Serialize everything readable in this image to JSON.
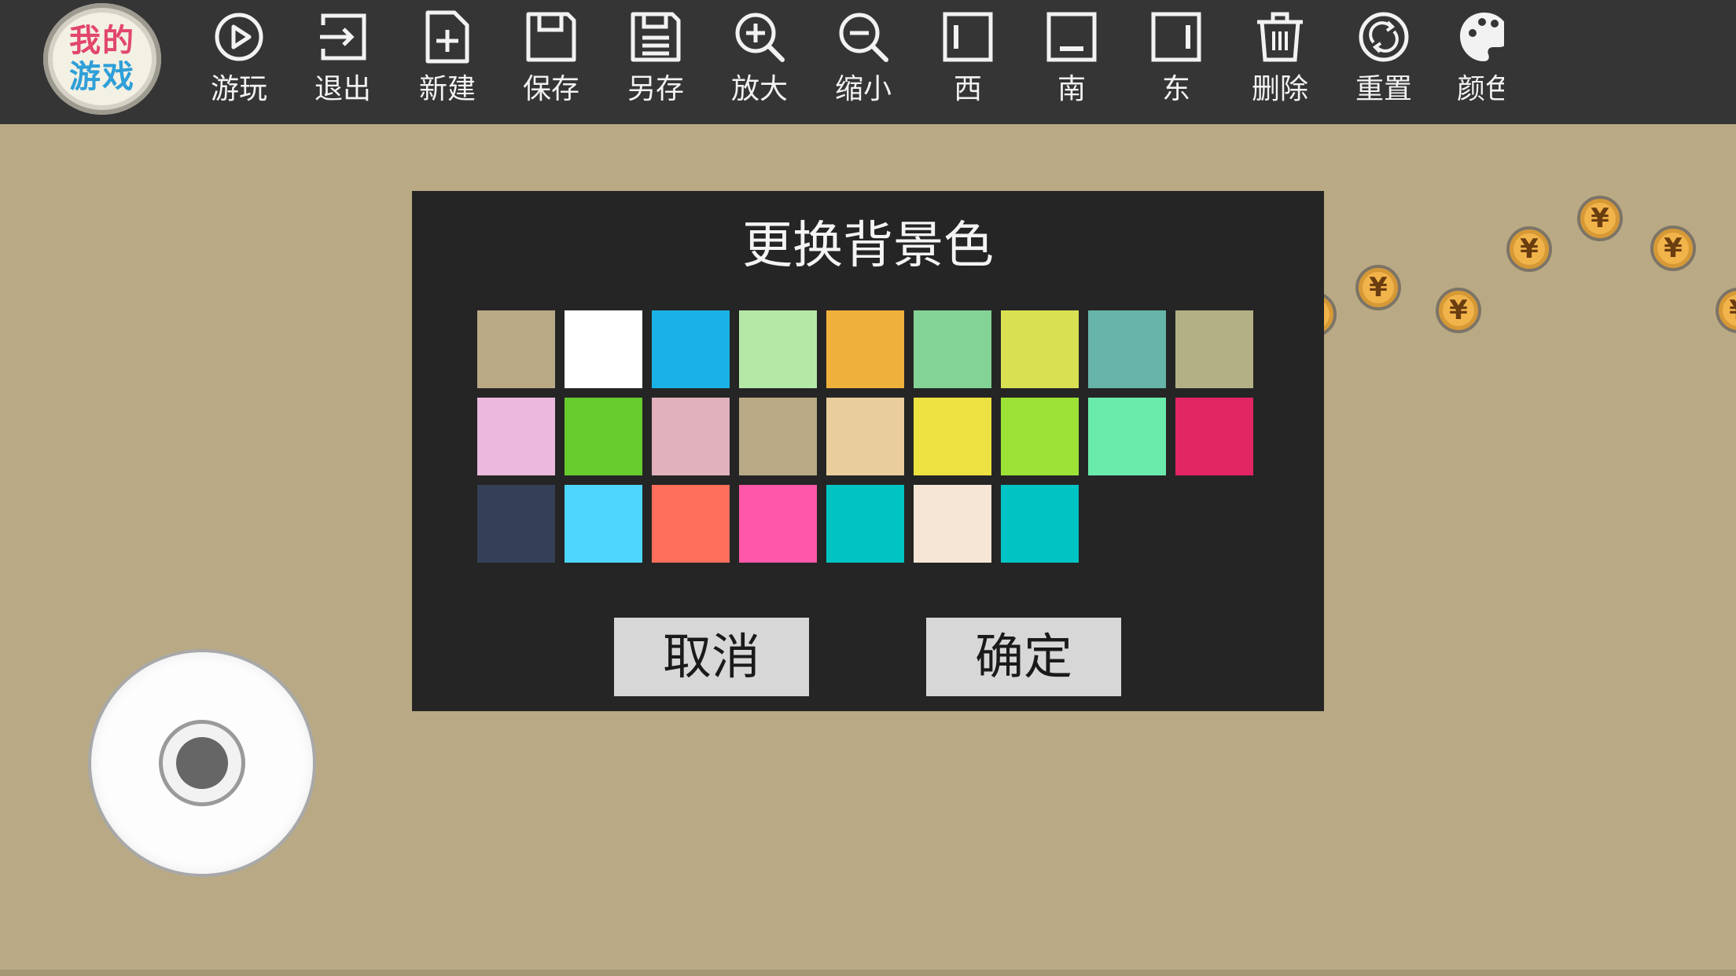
{
  "logo": {
    "line1": "我的",
    "line2": "游戏"
  },
  "toolbar": {
    "play": "游玩",
    "exit": "退出",
    "new": "新建",
    "save": "保存",
    "save_as": "另存",
    "zoom_in": "放大",
    "zoom_out": "缩小",
    "west": "西",
    "south": "南",
    "east": "东",
    "delete": "删除",
    "reset": "重置",
    "color": "颜色"
  },
  "dialog": {
    "title": "更换背景色",
    "cancel_label": "取消",
    "ok_label": "确定",
    "swatches": [
      "#b9aa85",
      "#ffffff",
      "#1ab1e6",
      "#b5e8a7",
      "#efb13c",
      "#83d397",
      "#d9e052",
      "#67b4a8",
      "#b3b085",
      "#ebb8de",
      "#66cc2e",
      "#e1b1bd",
      "#b9aa85",
      "#eacd9c",
      "#ece140",
      "#9ce236",
      "#6aebac",
      "#e22563",
      "#353f57",
      "#4ed6ff",
      "#ff6f5c",
      "#ff58a9",
      "#00c4c2",
      "#f6e6d5",
      "#00c4c4"
    ]
  },
  "coin_symbol": "¥",
  "colors": {
    "background": "#b9aa85",
    "toolbar": "#353535",
    "dialog": "#252525",
    "button": "#d7d7d7",
    "coin": "#f1b44b"
  }
}
